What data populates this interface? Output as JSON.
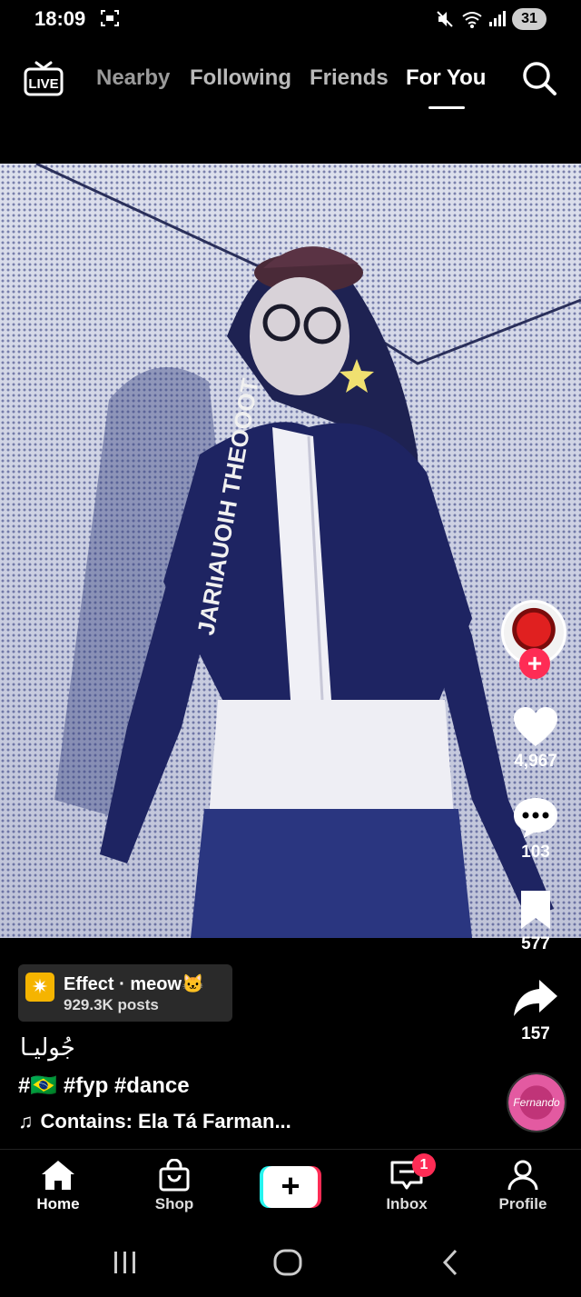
{
  "status_bar": {
    "time": "18:09",
    "battery": "31"
  },
  "top_nav": {
    "live_label": "LIVE",
    "tabs": [
      {
        "label": "Nearby"
      },
      {
        "label": "Following"
      },
      {
        "label": "Friends"
      },
      {
        "label": "For You",
        "active": true
      }
    ]
  },
  "video": {
    "overlay_text": "JARIıAUOIH THEOOOT"
  },
  "actions": {
    "likes": "4,967",
    "comments": "103",
    "bookmarks": "577",
    "shares": "157",
    "sound_disc_text": "Fernando Aura"
  },
  "caption": {
    "effect_name": "Effect · meow🐱",
    "effect_posts": "929.3K posts",
    "title": "جُوليـا",
    "hashtags": "#🇧🇷 #fyp #dance",
    "sound": "Contains: Ela Tá Farman..."
  },
  "bottom_nav": {
    "items": [
      {
        "label": "Home"
      },
      {
        "label": "Shop"
      },
      {
        "label": "Inbox",
        "badge": "1"
      },
      {
        "label": "Profile"
      }
    ]
  },
  "colors": {
    "accent": "#fe2c55",
    "cyan": "#25f4ee",
    "effect_icon": "#f5b400"
  }
}
